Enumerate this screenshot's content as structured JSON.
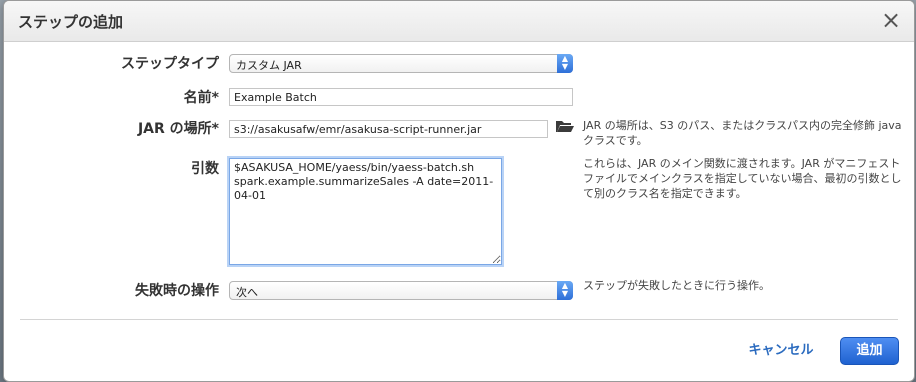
{
  "dialog": {
    "title": "ステップの追加",
    "close_glyph": "×"
  },
  "fields": {
    "step_type": {
      "label": "ステップタイプ",
      "value": "カスタム JAR"
    },
    "name": {
      "label": "名前*",
      "value": "Example Batch"
    },
    "jar_location": {
      "label": "JAR の場所*",
      "value": "s3://asakusafw/emr/asakusa-script-runner.jar",
      "help": "JAR の場所は、S3 のパス、またはクラスパス内の完全修飾 java クラスです。",
      "folder_icon": "folder-open-icon"
    },
    "arguments": {
      "label": "引数",
      "value": "$ASAKUSA_HOME/yaess/bin/yaess-batch.sh spark.example.summarizeSales -A date=2011-04-01",
      "help": "これらは、JAR のメイン関数に渡されます。JAR がマニフェストファイルでメインクラスを指定していない場合、最初の引数として別のクラス名を指定できます。"
    },
    "on_failure": {
      "label": "失敗時の操作",
      "value": "次へ",
      "help": "ステップが失敗したときに行う操作。"
    }
  },
  "footer": {
    "cancel_label": "キャンセル",
    "add_label": "追加"
  },
  "colors": {
    "accent": "#2b6bbf",
    "primary_button": "#2e6fd8"
  }
}
